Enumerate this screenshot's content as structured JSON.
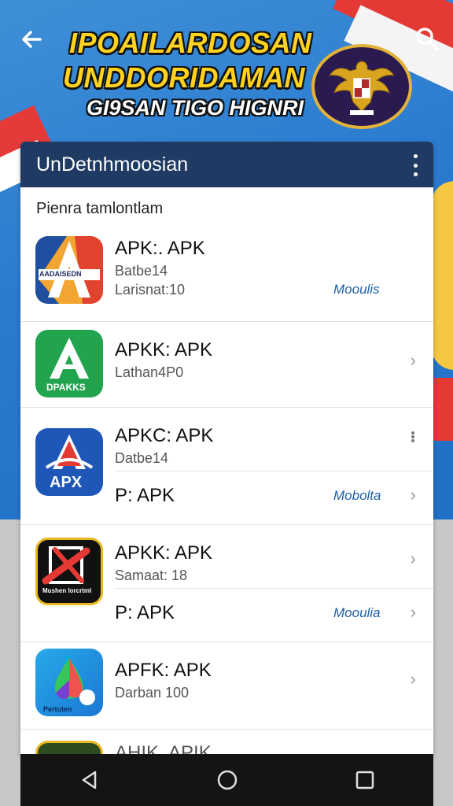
{
  "header": {
    "title_line1": "IPOAILARDOSAN",
    "title_line2": "UNDDORIDAMAN",
    "subtitle": "GI9SAN TIGO HIGNRI",
    "back_icon": "arrow-left-icon",
    "search_icon": "search-icon",
    "emblem": "garuda-emblem"
  },
  "panel": {
    "title": "UnDetnhmoosian",
    "menu_icon": "more-vertical-icon",
    "section_label": "Pienra tamlontlam"
  },
  "apps": [
    {
      "icon_text": "AADAISEDN",
      "name": "APK:. APK",
      "line1": "Batbe14",
      "line2": "Larisnat:10",
      "link": "Mooulis"
    },
    {
      "icon_text": "DPAKKS",
      "name": "APKK: APK",
      "line1": "Lathan4P0"
    },
    {
      "icon_text": "APX",
      "name": "APKC: APK",
      "line1": "Datbe14",
      "sub_name": "P: APK",
      "link": "Mobolta"
    },
    {
      "icon_text": "Mushen lorcrtml",
      "name": "APKK: APK",
      "line1": "Samaat: 18",
      "sub_name": "P: APK",
      "link": "Mooulia"
    },
    {
      "icon_text": "Pertuten",
      "name": "APFK: APK",
      "line1": "Darban 100"
    },
    {
      "name": "AHIK. APIK"
    }
  ],
  "navbar": {
    "back": "triangle-back-icon",
    "home": "circle-home-icon",
    "recents": "square-recents-icon"
  },
  "colors": {
    "header_bg": "#1f3b63",
    "title_yellow": "#ffd21f",
    "link_blue": "#1e5fa8",
    "navbar_bg": "#141414"
  }
}
